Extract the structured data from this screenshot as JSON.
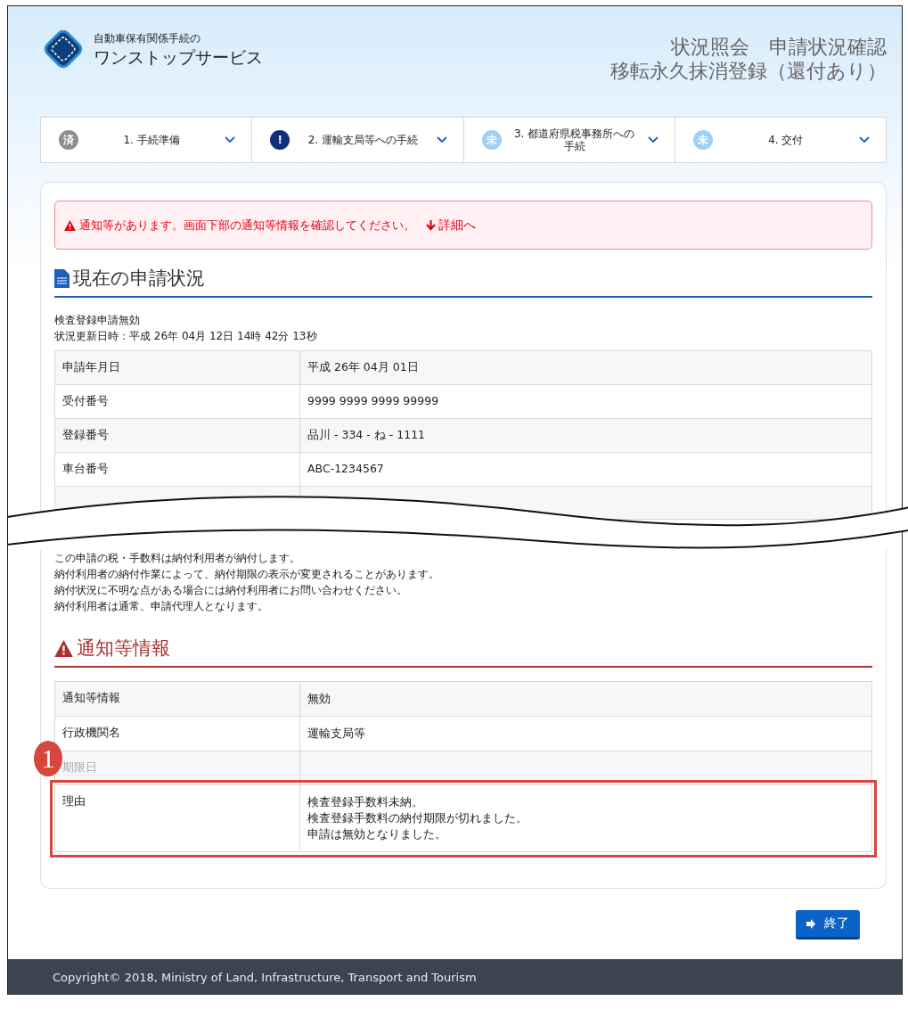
{
  "header": {
    "logo_caption": "自動車保有関係手続の",
    "logo_name": "ワンストップサービス",
    "title_lines": [
      "状況照会　申請状況確認",
      "移転永久抹消登録（還付あり）"
    ]
  },
  "steps": [
    {
      "kind": "done",
      "badge": "済",
      "label": "1. 手続準備"
    },
    {
      "kind": "alert",
      "badge": "!",
      "label": "2. 運輸支局等への手続"
    },
    {
      "kind": "pending",
      "badge": "未",
      "label": "3. 都道府県税事務所への手続"
    },
    {
      "kind": "pending",
      "badge": "未",
      "label": "4. 交付"
    }
  ],
  "alert": {
    "message": "通知等があります。画面下部の通知等情報を確認してください。",
    "link": "詳細へ"
  },
  "status_section": {
    "heading": "現在の申請状況",
    "status": "検査登録申請無効",
    "updated": "状況更新日時：平成 26年 04月 12日 14時 42分 13秒",
    "rows": [
      {
        "label": "申請年月日",
        "value": "平成 26年 04月 01日"
      },
      {
        "label": "受付番号",
        "value": "9999 9999 9999 99999"
      },
      {
        "label": "登録番号",
        "value": "品川 - 334 - ね - 1111"
      },
      {
        "label": "車台番号",
        "value": "ABC-1234567"
      }
    ]
  },
  "notes": [
    "この申請の税・手数料は納付利用者が納付します。",
    "納付利用者の納付作業によって、納付期限の表示が変更されることがあります。",
    "納付状況に不明な点がある場合には納付利用者にお問い合わせください。",
    "納付利用者は通常、申請代理人となります。"
  ],
  "notice_section": {
    "heading": "通知等情報",
    "rows": [
      {
        "label": "通知等情報",
        "lines": [
          "無効"
        ],
        "highlighted": false
      },
      {
        "label": "行政機関名",
        "lines": [
          "運輸支局等"
        ],
        "highlighted": false
      },
      {
        "label": "期限日",
        "lines": [],
        "highlighted": false,
        "callout": "1"
      },
      {
        "label": "理由",
        "lines": [
          "検査登録手数料未納。",
          "検査登録手数料の納付期限が切れました。",
          "申請は無効となりました。"
        ],
        "highlighted": true
      }
    ]
  },
  "end_button": "終了",
  "footer": "Copyright© 2018, Ministry of Land, Infrastructure, Transport and Tourism"
}
